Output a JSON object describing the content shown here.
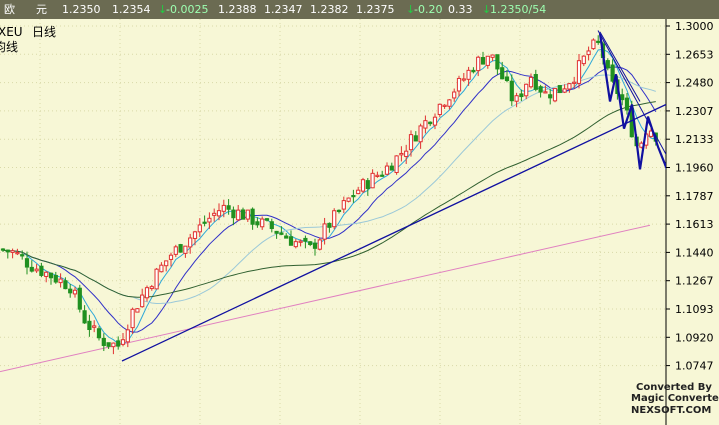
{
  "quote_bar": {
    "name_char1": "欧",
    "name_char2": "元",
    "price_last": "1.2350",
    "price_2": "1.2354",
    "change": "-0.0025",
    "price_3": "1.2388",
    "price_4": "1.2347",
    "price_5": "1.2382",
    "price_6": "1.2375",
    "change_pct": "-0.20",
    "value_7": "0.33",
    "bid_vol": "1.2350/54"
  },
  "chart_header": {
    "symbol": "XEU",
    "period": "日线",
    "indicator": "均线"
  },
  "watermark": {
    "line1": "Converted By",
    "line2": "Magic Converter",
    "line3": "NEXSOFT.COM"
  },
  "colors": {
    "background": "#f7f7d6",
    "grid": "#d9d9a8",
    "up_candle": "#ffffff",
    "down_candle": "#209020",
    "bear_body": "#e03030",
    "ma5": "#2ea8d8",
    "ma10": "#3030c8",
    "ma20": "#9ac8d8",
    "ma60": "#306030",
    "ma120": "#e080c0",
    "trendline": "#1010a0"
  },
  "chart_data": {
    "type": "candlestick",
    "ylim": [
      1.061,
      1.306
    ],
    "y_ticks": [
      "1.3000",
      "1.2653",
      "1.2480",
      "1.2307",
      "1.2133",
      "1.1960",
      "1.1787",
      "1.1613",
      "1.1440",
      "1.1267",
      "1.1093",
      "1.0920",
      "1.0747"
    ],
    "grid": true,
    "annotations": [
      "trendline",
      "downtrend arrows"
    ]
  }
}
